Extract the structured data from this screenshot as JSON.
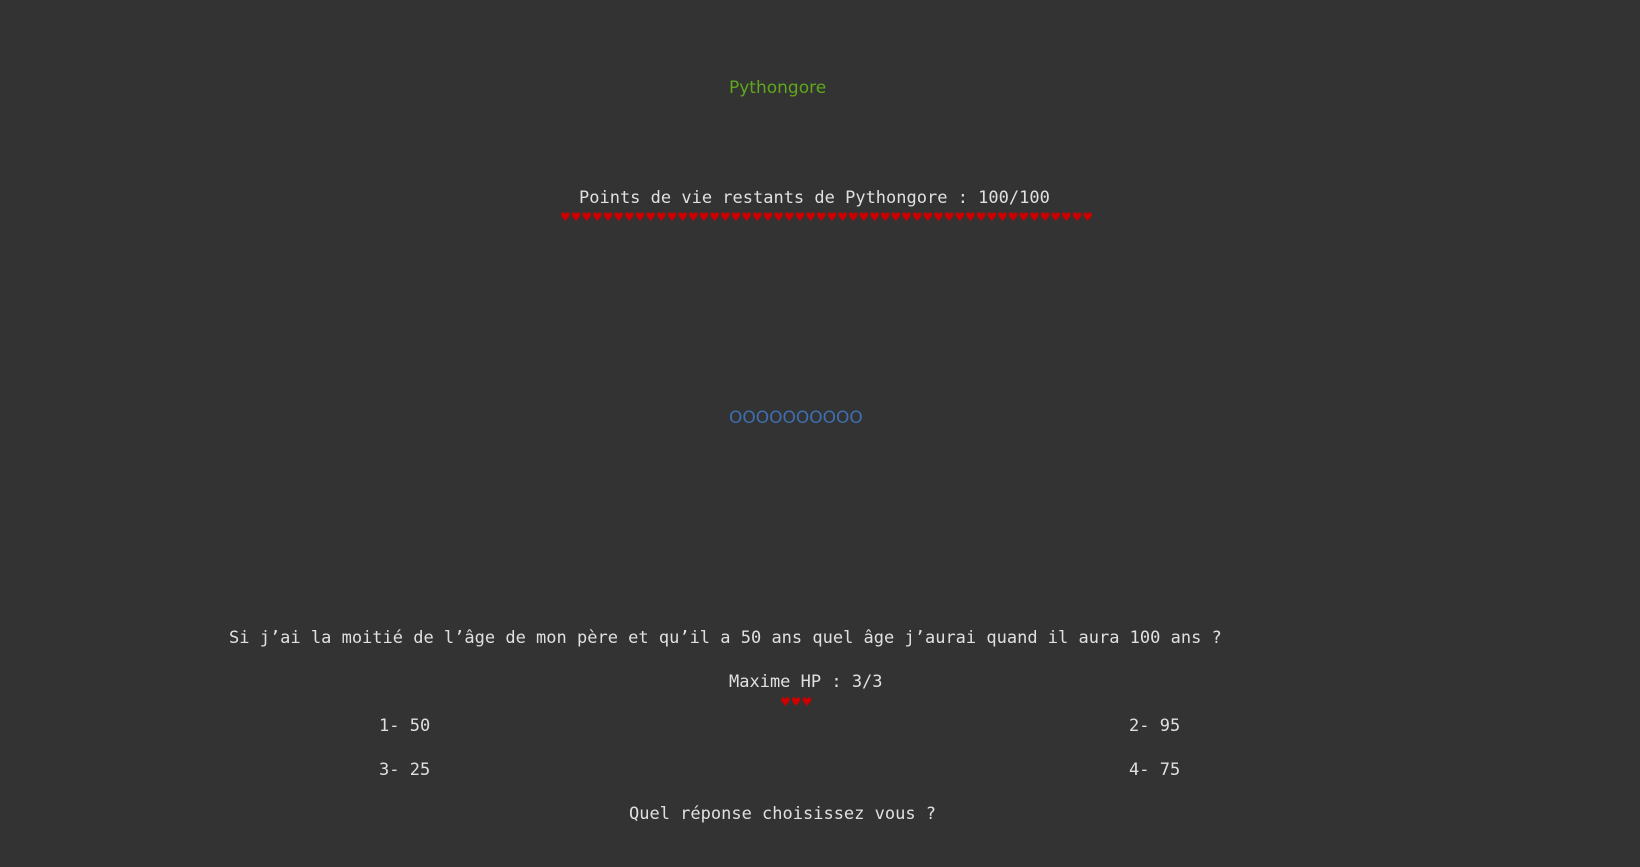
{
  "boss": {
    "name": "Pythongore",
    "hp_label": "Points de vie restants de Pythongore : 100/100",
    "hp_current": 100,
    "hp_max": 100,
    "hearts": "♥♥♥♥♥♥♥♥♥♥♥♥♥♥♥♥♥♥♥♥♥♥♥♥♥♥♥♥♥♥♥♥♥♥♥♥♥♥♥♥♥♥♥♥♥♥♥♥♥♥",
    "sprite": "OOOOOOOOOO"
  },
  "question": {
    "text": "Si j’ai la moitié de l’âge de mon père et qu’il a 50 ans quel âge j’aurai quand il aura 100 ans ?"
  },
  "player": {
    "hp_label": "Maxime HP : 3/3",
    "hp_current": 3,
    "hp_max": 3,
    "hearts": "♥♥♥"
  },
  "answers": [
    {
      "label": "1- 50"
    },
    {
      "label": "2- 95"
    },
    {
      "label": "3- 25"
    },
    {
      "label": "4- 75"
    }
  ],
  "prompt": "Quel réponse choisissez vous ?",
  "colors": {
    "background": "#333333",
    "text": "#e0e0e0",
    "boss_name": "#5fa81e",
    "hearts": "#cc0000",
    "sprite": "#3f6fb0"
  }
}
